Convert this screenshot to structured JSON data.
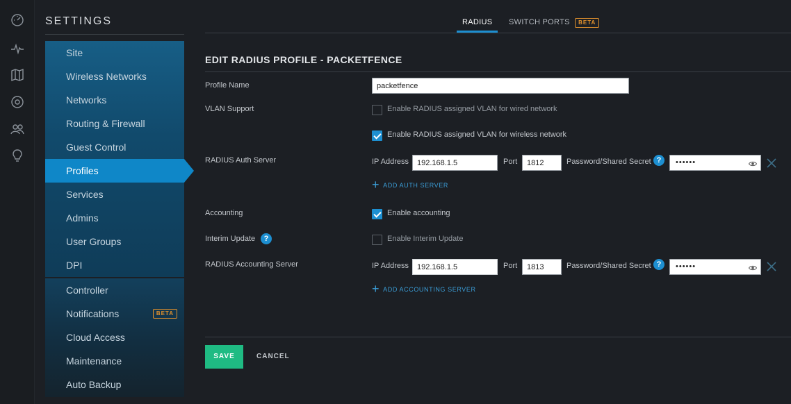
{
  "sidebar": {
    "title": "SETTINGS",
    "items": [
      {
        "label": "Site"
      },
      {
        "label": "Wireless Networks"
      },
      {
        "label": "Networks"
      },
      {
        "label": "Routing & Firewall"
      },
      {
        "label": "Guest Control"
      },
      {
        "label": "Profiles"
      },
      {
        "label": "Services"
      },
      {
        "label": "Admins"
      },
      {
        "label": "User Groups"
      },
      {
        "label": "DPI"
      }
    ],
    "items2": [
      {
        "label": "Controller"
      },
      {
        "label": "Notifications",
        "badge": "BETA"
      },
      {
        "label": "Cloud Access"
      },
      {
        "label": "Maintenance"
      },
      {
        "label": "Auto Backup"
      }
    ]
  },
  "tabs": {
    "radius": "RADIUS",
    "switch_ports": "SWITCH PORTS",
    "switch_ports_badge": "BETA"
  },
  "form": {
    "title": "EDIT RADIUS PROFILE - PACKETFENCE",
    "profile_name_label": "Profile Name",
    "profile_name_value": "packetfence",
    "vlan_support_label": "VLAN Support",
    "vlan_wired_label": "Enable RADIUS assigned VLAN for wired network",
    "vlan_wired_checked": false,
    "vlan_wireless_label": "Enable RADIUS assigned VLAN for wireless network",
    "vlan_wireless_checked": true,
    "auth_server_label": "RADIUS Auth Server",
    "auth": {
      "ip_label": "IP Address",
      "ip_value": "192.168.1.5",
      "port_label": "Port",
      "port_value": "1812",
      "secret_label": "Password/Shared Secret",
      "secret_value": "••••••"
    },
    "add_auth_server": "ADD AUTH SERVER",
    "accounting_label": "Accounting",
    "accounting_check_label": "Enable accounting",
    "accounting_checked": true,
    "interim_label": "Interim Update",
    "interim_check_label": "Enable Interim Update",
    "interim_checked": false,
    "acct_server_label": "RADIUS Accounting Server",
    "acct": {
      "ip_label": "IP Address",
      "ip_value": "192.168.1.5",
      "port_label": "Port",
      "port_value": "1813",
      "secret_label": "Password/Shared Secret",
      "secret_value": "••••••"
    },
    "add_acct_server": "ADD ACCOUNTING SERVER",
    "help_glyph": "?"
  },
  "actions": {
    "save": "SAVE",
    "cancel": "CANCEL"
  },
  "colors": {
    "accent": "#1d8fd1",
    "save": "#1fbb83",
    "beta": "#e0902d"
  }
}
